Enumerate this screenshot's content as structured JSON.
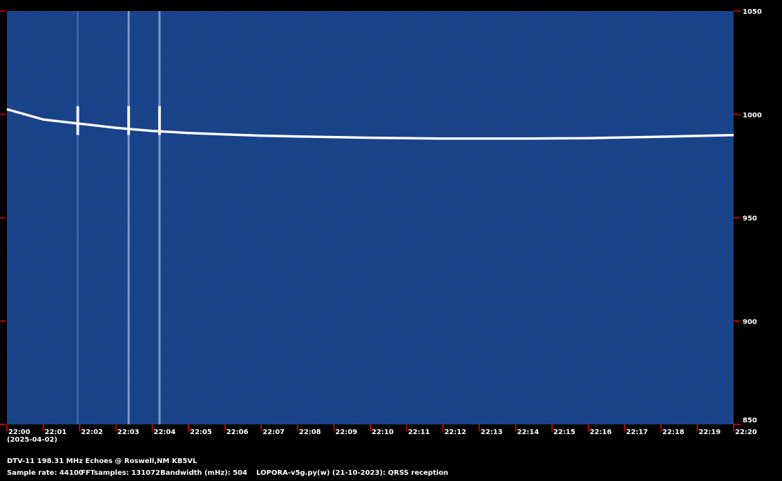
{
  "chart_data": {
    "type": "heatmap",
    "title": "DTV-11 198.31 MHz Echoes @ Roswell,NM KB5VL",
    "date": "(2025-04-02)",
    "x_ticks": [
      "22:00",
      "22:01",
      "22:02",
      "22:03",
      "22:04",
      "22:05",
      "22:06",
      "22:07",
      "22:08",
      "22:09",
      "22:10",
      "22:11",
      "22:12",
      "22:13",
      "22:14",
      "22:15",
      "22:16",
      "22:17",
      "22:18",
      "22:19",
      "22:20"
    ],
    "y_ticks": [
      "850",
      "900",
      "950",
      "1000",
      "1050"
    ],
    "ylim": [
      850,
      1050
    ],
    "xlim_minutes": [
      0,
      20
    ],
    "carrier_trace": {
      "x_minutes": [
        0,
        1,
        2,
        3,
        4,
        5,
        6,
        7,
        8,
        10,
        12,
        14,
        16,
        18,
        20
      ],
      "y_frequency": [
        1002.5,
        997.5,
        995.5,
        993.5,
        992,
        991,
        990.3,
        989.7,
        989.3,
        988.7,
        988.3,
        988.3,
        988.5,
        989.2,
        990
      ]
    },
    "echo_events_minutes": [
      1.95,
      3.35,
      4.2
    ],
    "colors": {
      "background": "#0a2a6e",
      "signal": "#ffffff",
      "tick": "#c00000",
      "text": "#ffffff"
    }
  },
  "footer": {
    "sample_rate": "Sample rate: 44100",
    "fft_samples": "FFTsamples: 131072",
    "bandwidth": "Bandwidth (mHz): 504",
    "software": "LOPORA-v5g.py(w) (21-10-2023): QRSS reception"
  }
}
